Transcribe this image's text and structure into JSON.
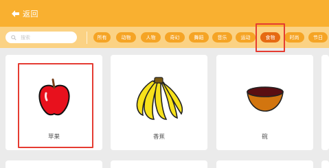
{
  "header": {
    "back_label": "返回"
  },
  "search": {
    "placeholder": "搜索"
  },
  "categories": [
    {
      "label": "所有",
      "active": false
    },
    {
      "label": "动物",
      "active": false
    },
    {
      "label": "人物",
      "active": false
    },
    {
      "label": "奇幻",
      "active": false
    },
    {
      "label": "舞蹈",
      "active": false
    },
    {
      "label": "音乐",
      "active": false
    },
    {
      "label": "运动",
      "active": false
    },
    {
      "label": "食物",
      "active": true
    },
    {
      "label": "时尚",
      "active": false
    },
    {
      "label": "节日",
      "active": false
    }
  ],
  "items": [
    {
      "label": "苹果",
      "icon": "apple-icon"
    },
    {
      "label": "香蕉",
      "icon": "banana-icon"
    },
    {
      "label": "碗",
      "icon": "bowl-icon"
    }
  ],
  "colors": {
    "header": "#f9b030",
    "filterbar": "#fbd284",
    "tag": "#f5a425",
    "tag_active": "#e66a12",
    "highlight": "#e53b31"
  }
}
